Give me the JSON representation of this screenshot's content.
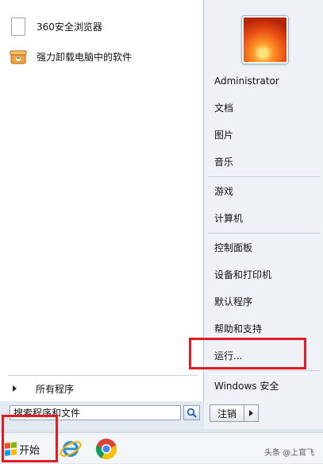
{
  "programs": [
    {
      "label": "360安全浏览器",
      "icon": "document-icon"
    },
    {
      "label": "强力卸载电脑中的软件",
      "icon": "uninstaller-box-icon"
    }
  ],
  "all_programs": "所有程序",
  "search": {
    "value": "搜索程序和文件",
    "icon": "search-icon"
  },
  "right_menu": {
    "user": "Administrator",
    "documents": "文档",
    "pictures": "图片",
    "music": "音乐",
    "games": "游戏",
    "computer": "计算机",
    "control_panel": "控制面板",
    "devices_printers": "设备和打印机",
    "default_programs": "默认程序",
    "help": "帮助和支持",
    "run": "运行...",
    "security": "Windows 安全"
  },
  "shutdown_label": "注销",
  "taskbar": {
    "start_label": "开始",
    "apps": [
      "internet-explorer-icon",
      "chrome-icon"
    ]
  },
  "watermark": "头条 @上官飞",
  "highlight_color": "#e21b24"
}
